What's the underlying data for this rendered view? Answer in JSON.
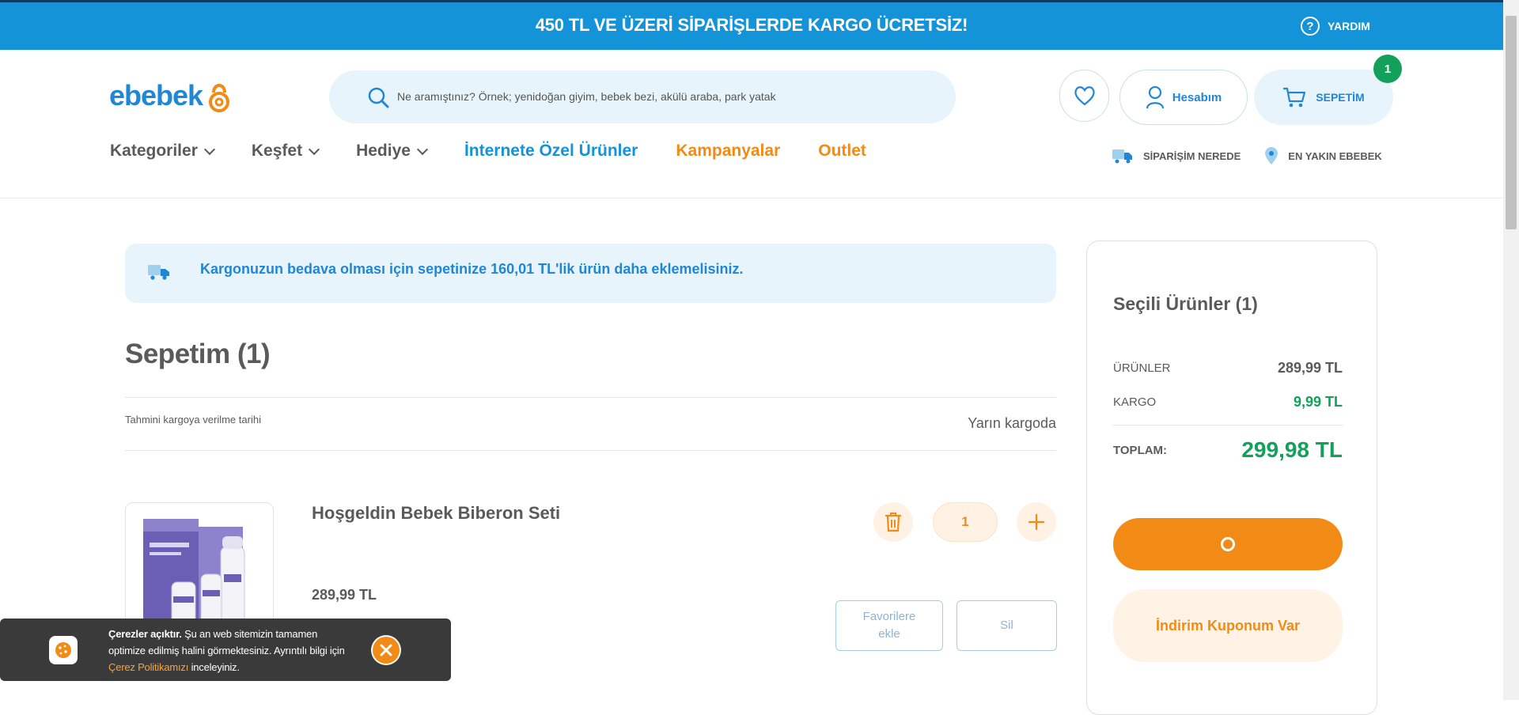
{
  "topbar": {
    "promo": "450 TL VE ÜZERİ SİPARİŞLERDE KARGO ÜCRETSİZ!",
    "help_label": "YARDIM"
  },
  "header": {
    "logo_text": "ebebek",
    "search_placeholder": "Ne aramıştınız? Örnek; yenidoğan giyim, bebek bezi, akülü araba, park yatak",
    "account_label": "Hesabım",
    "cart_label": "SEPETİM",
    "cart_count": "1"
  },
  "nav": {
    "items": [
      {
        "label": "Kategoriler"
      },
      {
        "label": "Keşfet"
      },
      {
        "label": "Hediye"
      },
      {
        "label": "İnternete Özel Ürünler"
      },
      {
        "label": "Kampanyalar"
      },
      {
        "label": "Outlet"
      }
    ],
    "order_tracking": "SİPARİŞİM NEREDE",
    "nearest_store": "EN YAKIN EBEBEK"
  },
  "cart": {
    "shipping_notice": "Kargonuzun bedava olması için sepetinize 160,01 TL'lik ürün daha eklemelisiniz.",
    "title": "Sepetim (1)",
    "eta_label": "Tahmini kargoya verilme tarihi",
    "eta_value": "Yarın kargoda",
    "items": [
      {
        "name": "Hoşgeldin Bebek Biberon Seti",
        "price": "289,99 TL",
        "quantity": "1",
        "favorite_label": "Favorilere ekle",
        "delete_label": "Sil"
      }
    ]
  },
  "summary": {
    "title": "Seçili Ürünler (1)",
    "products_label": "ÜRÜNLER",
    "products_value": "289,99 TL",
    "shipping_label": "KARGO",
    "shipping_value": "9,99 TL",
    "total_label": "TOPLAM:",
    "total_value": "299,98 TL",
    "coupon_label": "İndirim Kuponum Var"
  },
  "cookie": {
    "bold": "Çerezler açıktır.",
    "text_before_link": " Şu an web sitemizin tamamen optimize edilmiş halini görmektesiniz. Ayrıntılı bilgi için ",
    "link": "Çerez Politikamızı",
    "text_after_link": " inceleyiniz."
  },
  "colors": {
    "brand_blue": "#1493d9",
    "accent_orange": "#f28a16",
    "success_green": "#12a05a"
  }
}
